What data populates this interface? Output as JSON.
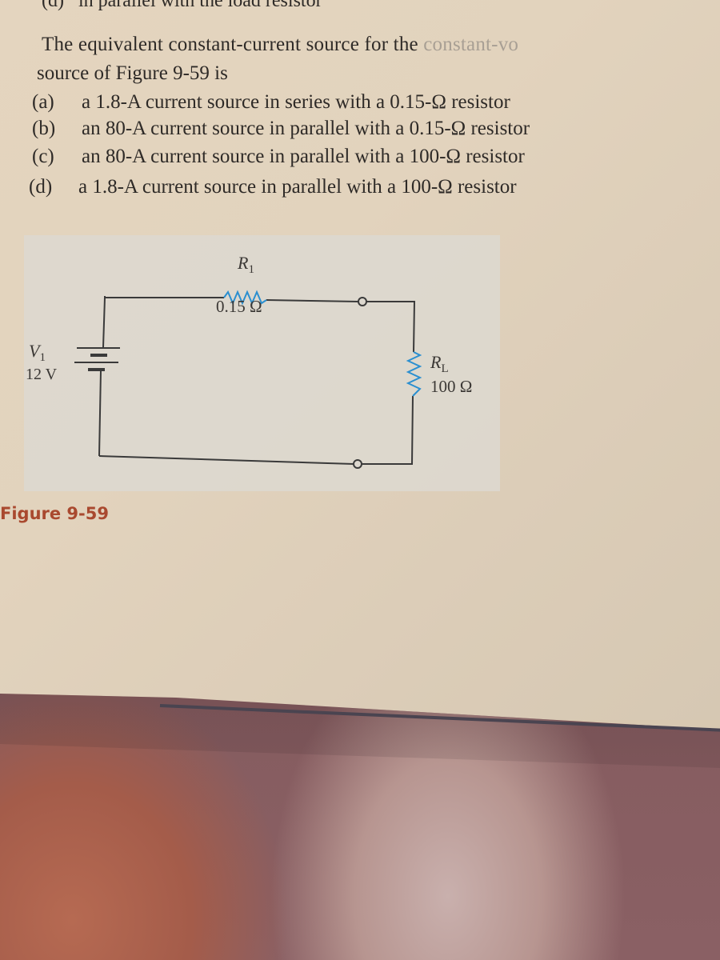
{
  "previous_option": {
    "label": "(d)",
    "text": "in parallel with the load resistor"
  },
  "question": {
    "line1_start": "The equivalent constant-current source for the ",
    "line1_faded": "constant-vo",
    "line2": "source of Figure 9-59 is"
  },
  "options": [
    {
      "label": "(a)",
      "text": "a 1.8-A current source in series with a 0.15-Ω resistor"
    },
    {
      "label": "(b)",
      "text": "an 80-A current source in parallel with a 0.15-Ω resistor"
    },
    {
      "label": "(c)",
      "text": "an 80-A current source in parallel with a 100-Ω resistor"
    },
    {
      "label": "(d)",
      "text": "a 1.8-A current source in parallel with a 100-Ω resistor"
    }
  ],
  "figure": {
    "caption": "Figure 9-59",
    "source": {
      "name": "V",
      "subscript": "1",
      "value": "12 V"
    },
    "series_resistor": {
      "name": "R",
      "subscript": "1",
      "value": "0.15 Ω"
    },
    "load_resistor": {
      "name": "R",
      "subscript": "L",
      "value": "100 Ω"
    },
    "colors": {
      "resistor": "#2a8fd0",
      "wire": "#3a3a3a",
      "caption": "#a9492f"
    }
  }
}
